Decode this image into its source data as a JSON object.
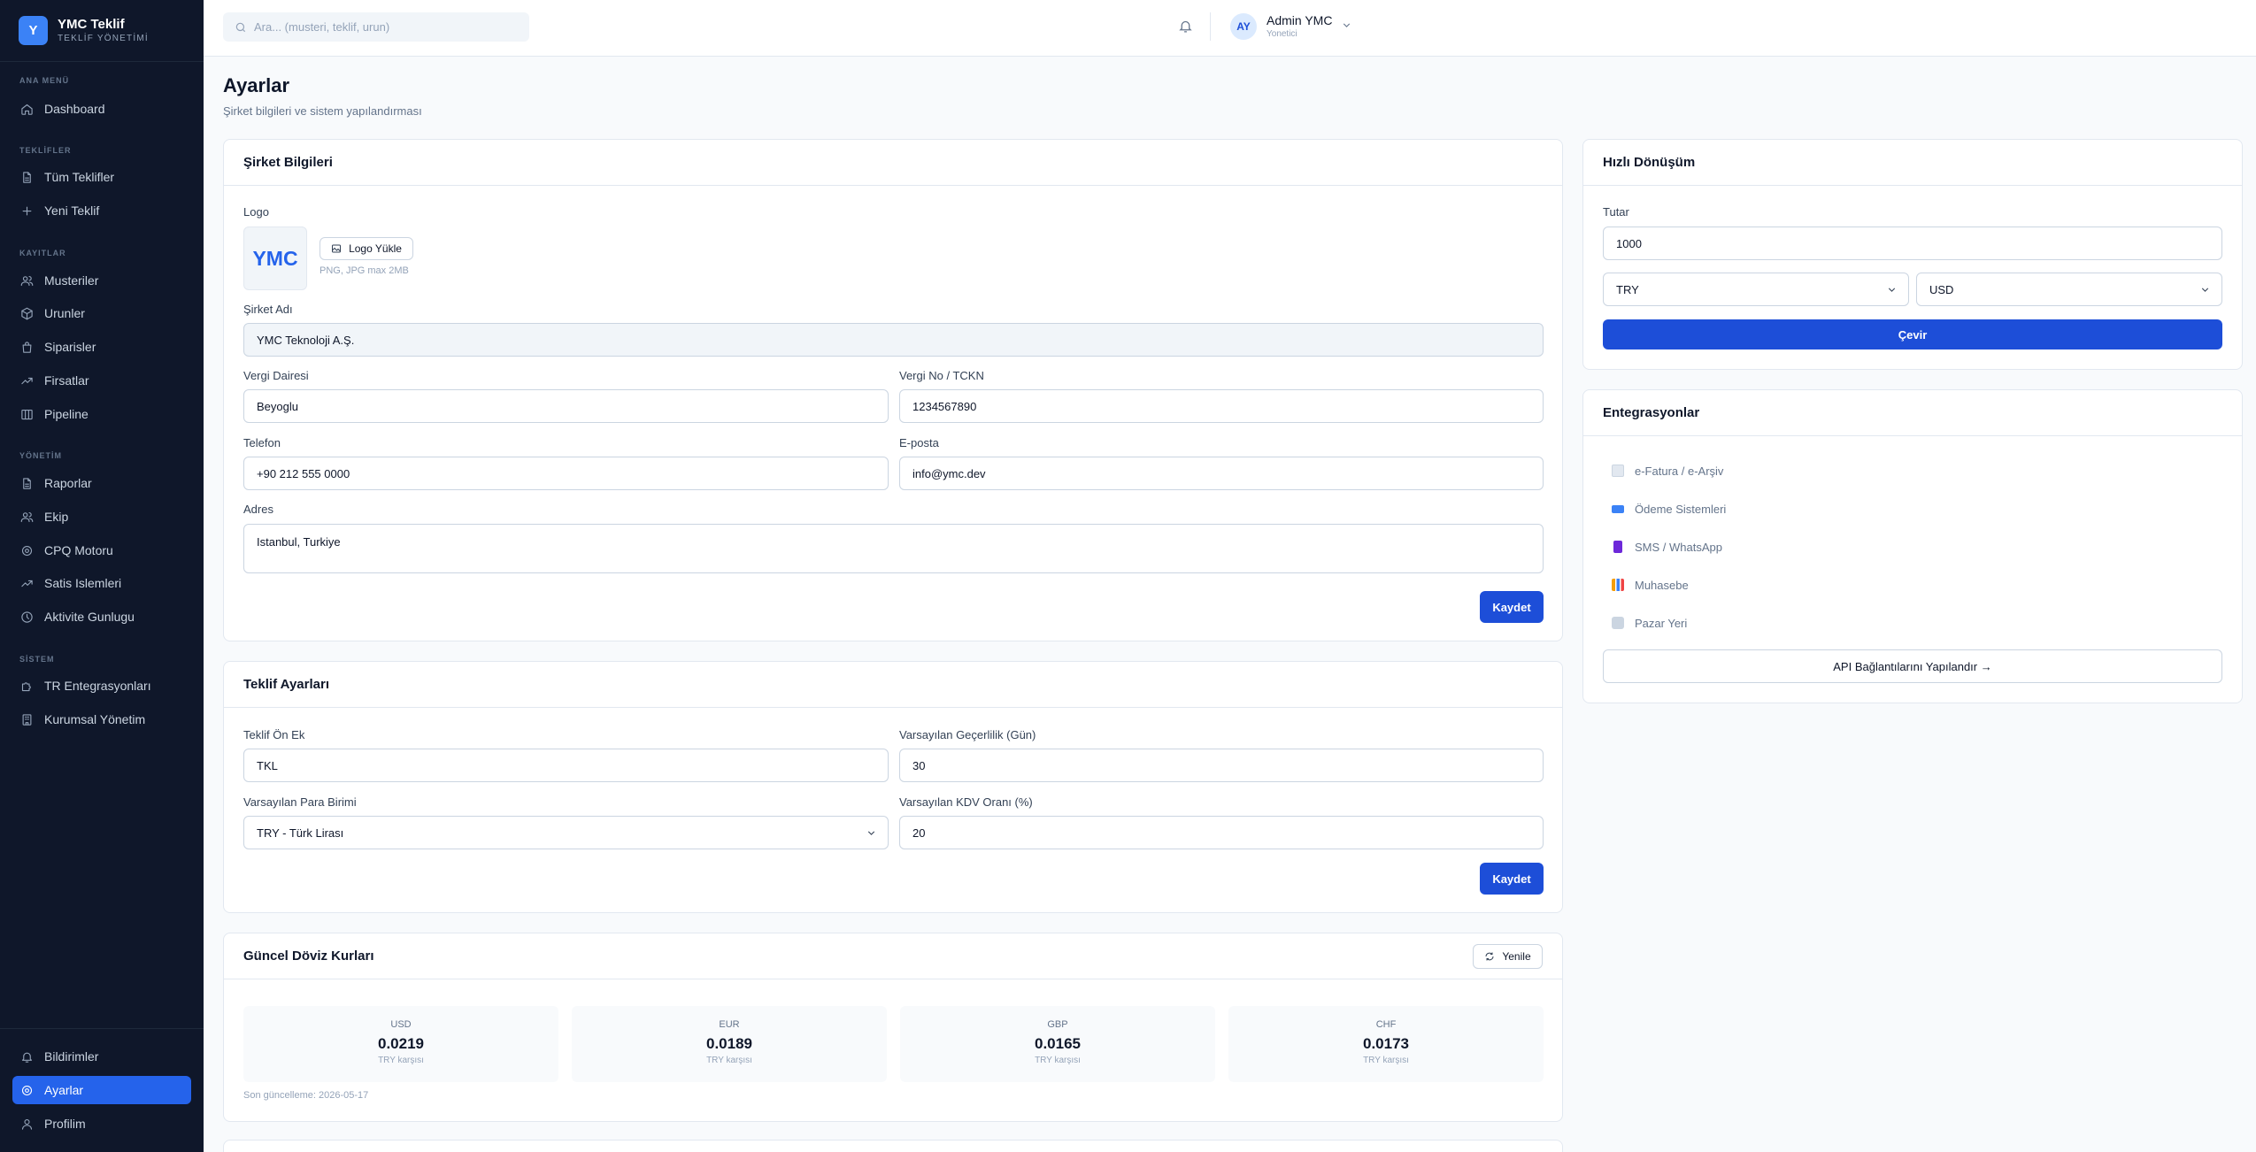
{
  "brand": {
    "logo_letter": "Y",
    "title": "YMC Teklif",
    "subtitle": "TEKLİF YÖNETİMİ"
  },
  "sidebar": {
    "sections": {
      "ana_menu": "ANA MENÜ",
      "teklifler": "TEKLİFLER",
      "kayitlar": "KAYITLAR",
      "yonetim": "YÖNETİM",
      "sistem": "SİSTEM"
    },
    "items": {
      "dashboard": "Dashboard",
      "tum_teklifler": "Tüm Teklifler",
      "yeni_teklif": "Yeni Teklif",
      "musteriler": "Musteriler",
      "urunler": "Urunler",
      "siparisler": "Siparisler",
      "firsatlar": "Firsatlar",
      "pipeline": "Pipeline",
      "raporlar": "Raporlar",
      "ekip": "Ekip",
      "cpq": "CPQ Motoru",
      "satis": "Satis Islemleri",
      "aktivite": "Aktivite Gunlugu",
      "tr_entegrasyon": "TR Entegrasyonları",
      "kurumsal": "Kurumsal Yönetim",
      "bildirimler": "Bildirimler",
      "ayarlar": "Ayarlar",
      "profilim": "Profilim"
    }
  },
  "topbar": {
    "search_placeholder": "Ara... (musteri, teklif, urun)",
    "user": {
      "initials": "AY",
      "name": "Admin YMC",
      "role": "Yonetici"
    }
  },
  "page": {
    "title": "Ayarlar",
    "subtitle": "Şirket bilgileri ve sistem yapılandırması"
  },
  "company": {
    "title": "Şirket Bilgileri",
    "logo_label": "Logo",
    "logo_text": "YMC",
    "upload_button": "Logo Yükle",
    "upload_hint": "PNG, JPG max 2MB",
    "name_label": "Şirket Adı",
    "name_value": "YMC Teknoloji A.Ş.",
    "tax_office_label": "Vergi Dairesi",
    "tax_office_value": "Beyoglu",
    "tax_no_label": "Vergi No / TCKN",
    "tax_no_value": "1234567890",
    "phone_label": "Telefon",
    "phone_value": "+90 212 555 0000",
    "email_label": "E-posta",
    "email_value": "info@ymc.dev",
    "address_label": "Adres",
    "address_value": "Istanbul, Turkiye",
    "save_button": "Kaydet"
  },
  "quote_settings": {
    "title": "Teklif Ayarları",
    "prefix_label": "Teklif Ön Ek",
    "prefix_value": "TKL",
    "validity_label": "Varsayılan Geçerlilik (Gün)",
    "validity_value": "30",
    "currency_label": "Varsayılan Para Birimi",
    "currency_value": "TRY - Türk Lirası",
    "vat_label": "Varsayılan KDV Oranı (%)",
    "vat_value": "20",
    "save_button": "Kaydet"
  },
  "rates": {
    "title": "Güncel Döviz Kurları",
    "refresh_button": "Yenile",
    "items": [
      {
        "code": "USD",
        "value": "0.0219",
        "caption": "TRY karşısı"
      },
      {
        "code": "EUR",
        "value": "0.0189",
        "caption": "TRY karşısı"
      },
      {
        "code": "GBP",
        "value": "0.0165",
        "caption": "TRY karşısı"
      },
      {
        "code": "CHF",
        "value": "0.0173",
        "caption": "TRY karşısı"
      }
    ],
    "updated": "Son güncelleme: 2026-05-17"
  },
  "converter": {
    "title": "Hızlı Dönüşüm",
    "amount_label": "Tutar",
    "amount_value": "1000",
    "from_currency": "TRY",
    "to_currency": "USD",
    "convert_button": "Çevir"
  },
  "integrations": {
    "title": "Entegrasyonlar",
    "items": [
      {
        "label": "e-Fatura / e-Arşiv",
        "icon": "page-icon",
        "color": "#cbd5e1"
      },
      {
        "label": "Ödeme Sistemleri",
        "icon": "credit-card-icon",
        "color": "#3b82f6"
      },
      {
        "label": "SMS / WhatsApp",
        "icon": "phone-icon",
        "color": "#7c3aed"
      },
      {
        "label": "Muhasebe",
        "icon": "bar-chart-icon",
        "color": "#f59e0b"
      },
      {
        "label": "Pazar Yeri",
        "icon": "cart-icon",
        "color": "#94a3b8"
      }
    ],
    "configure_button": "API Bağlantılarını Yapılandır →"
  }
}
